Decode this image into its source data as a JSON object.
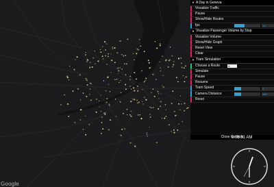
{
  "map": {
    "provider_logo": "Google",
    "background_color": "#1b1b1d",
    "point_color": "#e6d98a"
  },
  "gui": {
    "folders": [
      {
        "title": "A Day in Geneva",
        "rows": [
          {
            "label": "Visualize Traffic",
            "type": "button"
          },
          {
            "label": "Pause",
            "type": "button"
          },
          {
            "label": "Show/Hide Routes",
            "type": "button"
          },
          {
            "label": "fps",
            "type": "number",
            "value": "13",
            "fill_fraction": 0.4
          }
        ]
      },
      {
        "title": "Visualize Passenger Volume by Stop",
        "rows": [
          {
            "label": "Visualize Volume",
            "type": "button"
          },
          {
            "label": "Show/Hide Graph",
            "type": "button"
          },
          {
            "label": "Reset View",
            "type": "button"
          },
          {
            "label": "Clear",
            "type": "button"
          }
        ]
      },
      {
        "title": "Tram Simulation",
        "rows": [
          {
            "label": "Choose a Route",
            "type": "select",
            "value": "A"
          },
          {
            "label": "Simulate",
            "type": "button"
          },
          {
            "label": "Pause",
            "type": "button"
          },
          {
            "label": "Resume",
            "type": "button"
          },
          {
            "label": "Tram Speed",
            "type": "number",
            "value": "3",
            "fill_fraction": 0.25
          },
          {
            "label": "Camera Distance",
            "type": "number",
            "value": "500",
            "fill_fraction": 0.25
          },
          {
            "label": "Reset",
            "type": "button"
          }
        ]
      }
    ],
    "close_label": "Close Controls"
  },
  "clock": {
    "digital_time": "6:08:31 AM"
  }
}
